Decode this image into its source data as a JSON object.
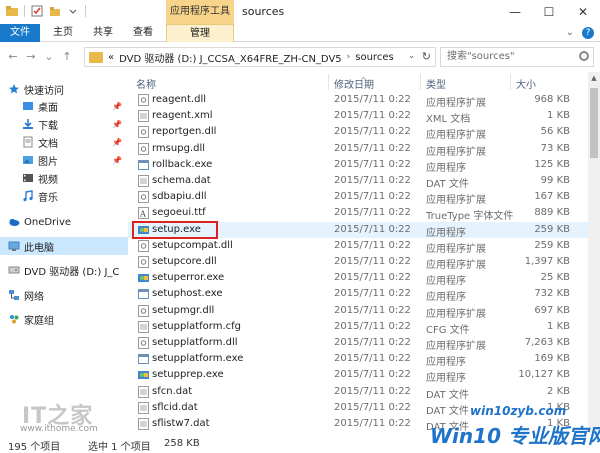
{
  "window": {
    "title": "sources",
    "context_tab": "应用程序工具",
    "controls": [
      "minimize",
      "maximize",
      "close"
    ]
  },
  "ribbon": {
    "tabs": [
      "文件",
      "主页",
      "共享",
      "查看",
      "管理"
    ]
  },
  "address": {
    "breadcrumb": [
      "DVD 驱动器 (D:) J_CCSA_X64FRE_ZH-CN_DV5",
      "sources"
    ],
    "prefix": "«",
    "search_placeholder": "搜索\"sources\""
  },
  "nav": {
    "items": [
      {
        "label": "快速访问",
        "icon": "star-icon",
        "pinned": false
      },
      {
        "label": "桌面",
        "icon": "desktop-icon",
        "pinned": true
      },
      {
        "label": "下载",
        "icon": "download-icon",
        "pinned": true
      },
      {
        "label": "文档",
        "icon": "documents-icon",
        "pinned": true
      },
      {
        "label": "图片",
        "icon": "pictures-icon",
        "pinned": true
      },
      {
        "label": "视频",
        "icon": "videos-icon",
        "pinned": false
      },
      {
        "label": "音乐",
        "icon": "music-icon",
        "pinned": false
      },
      {
        "label": "OneDrive",
        "icon": "onedrive-icon",
        "pinned": false
      },
      {
        "label": "此电脑",
        "icon": "computer-icon",
        "pinned": false
      },
      {
        "label": "DVD 驱动器 (D:) J_C",
        "icon": "dvd-icon",
        "pinned": false
      },
      {
        "label": "网络",
        "icon": "network-icon",
        "pinned": false
      },
      {
        "label": "家庭组",
        "icon": "homegroup-icon",
        "pinned": false
      }
    ]
  },
  "columns": {
    "name": "名称",
    "date": "修改日期",
    "type": "类型",
    "size": "大小"
  },
  "files": [
    {
      "name": "reagent.dll",
      "date": "2015/7/11 0:22",
      "type": "应用程序扩展",
      "size": "968 KB",
      "icon": "dll"
    },
    {
      "name": "reagent.xml",
      "date": "2015/7/11 0:22",
      "type": "XML 文档",
      "size": "1 KB",
      "icon": "doc"
    },
    {
      "name": "reportgen.dll",
      "date": "2015/7/11 0:22",
      "type": "应用程序扩展",
      "size": "56 KB",
      "icon": "dll"
    },
    {
      "name": "rmsupg.dll",
      "date": "2015/7/11 0:22",
      "type": "应用程序扩展",
      "size": "73 KB",
      "icon": "dll"
    },
    {
      "name": "rollback.exe",
      "date": "2015/7/11 0:22",
      "type": "应用程序",
      "size": "125 KB",
      "icon": "exe"
    },
    {
      "name": "schema.dat",
      "date": "2015/7/11 0:22",
      "type": "DAT 文件",
      "size": "99 KB",
      "icon": "doc"
    },
    {
      "name": "sdbapiu.dll",
      "date": "2015/7/11 0:22",
      "type": "应用程序扩展",
      "size": "167 KB",
      "icon": "dll"
    },
    {
      "name": "segoeui.ttf",
      "date": "2015/7/11 0:22",
      "type": "TrueType 字体文件",
      "size": "889 KB",
      "icon": "font"
    },
    {
      "name": "setup.exe",
      "date": "2015/7/11 0:22",
      "type": "应用程序",
      "size": "259 KB",
      "icon": "setup"
    },
    {
      "name": "setupcompat.dll",
      "date": "2015/7/11 0:22",
      "type": "应用程序扩展",
      "size": "259 KB",
      "icon": "dll"
    },
    {
      "name": "setupcore.dll",
      "date": "2015/7/11 0:22",
      "type": "应用程序扩展",
      "size": "1,397 KB",
      "icon": "dll"
    },
    {
      "name": "setuperror.exe",
      "date": "2015/7/11 0:22",
      "type": "应用程序",
      "size": "25 KB",
      "icon": "setup"
    },
    {
      "name": "setuphost.exe",
      "date": "2015/7/11 0:22",
      "type": "应用程序",
      "size": "732 KB",
      "icon": "exe"
    },
    {
      "name": "setupmgr.dll",
      "date": "2015/7/11 0:22",
      "type": "应用程序扩展",
      "size": "697 KB",
      "icon": "dll"
    },
    {
      "name": "setupplatform.cfg",
      "date": "2015/7/11 0:22",
      "type": "CFG 文件",
      "size": "1 KB",
      "icon": "doc"
    },
    {
      "name": "setupplatform.dll",
      "date": "2015/7/11 0:22",
      "type": "应用程序扩展",
      "size": "7,263 KB",
      "icon": "dll"
    },
    {
      "name": "setupplatform.exe",
      "date": "2015/7/11 0:22",
      "type": "应用程序",
      "size": "169 KB",
      "icon": "exe"
    },
    {
      "name": "setupprep.exe",
      "date": "2015/7/11 0:22",
      "type": "应用程序",
      "size": "10,127 KB",
      "icon": "setup"
    },
    {
      "name": "sfcn.dat",
      "date": "2015/7/11 0:22",
      "type": "DAT 文件",
      "size": "2 KB",
      "icon": "doc"
    },
    {
      "name": "sflcid.dat",
      "date": "2015/7/11 0:22",
      "type": "DAT 文件",
      "size": "1 KB",
      "icon": "doc"
    },
    {
      "name": "sflistw7.dat",
      "date": "2015/7/11 0:22",
      "type": "DAT 文件",
      "size": "1 KB",
      "icon": "doc"
    }
  ],
  "status": {
    "count": "195 个项目",
    "selected": "选中 1 个项目",
    "size": "258 KB"
  },
  "watermarks": {
    "left_logo": "IT之家",
    "left_url": "www.ithome.com",
    "right_url": "win10zyb.com",
    "right_logo": "Win10 专业版官网"
  },
  "colors": {
    "accent": "#1979ca",
    "context_tab": "#f8d48a",
    "selection": "#cce8ff",
    "highlight_box": "#e02020"
  }
}
